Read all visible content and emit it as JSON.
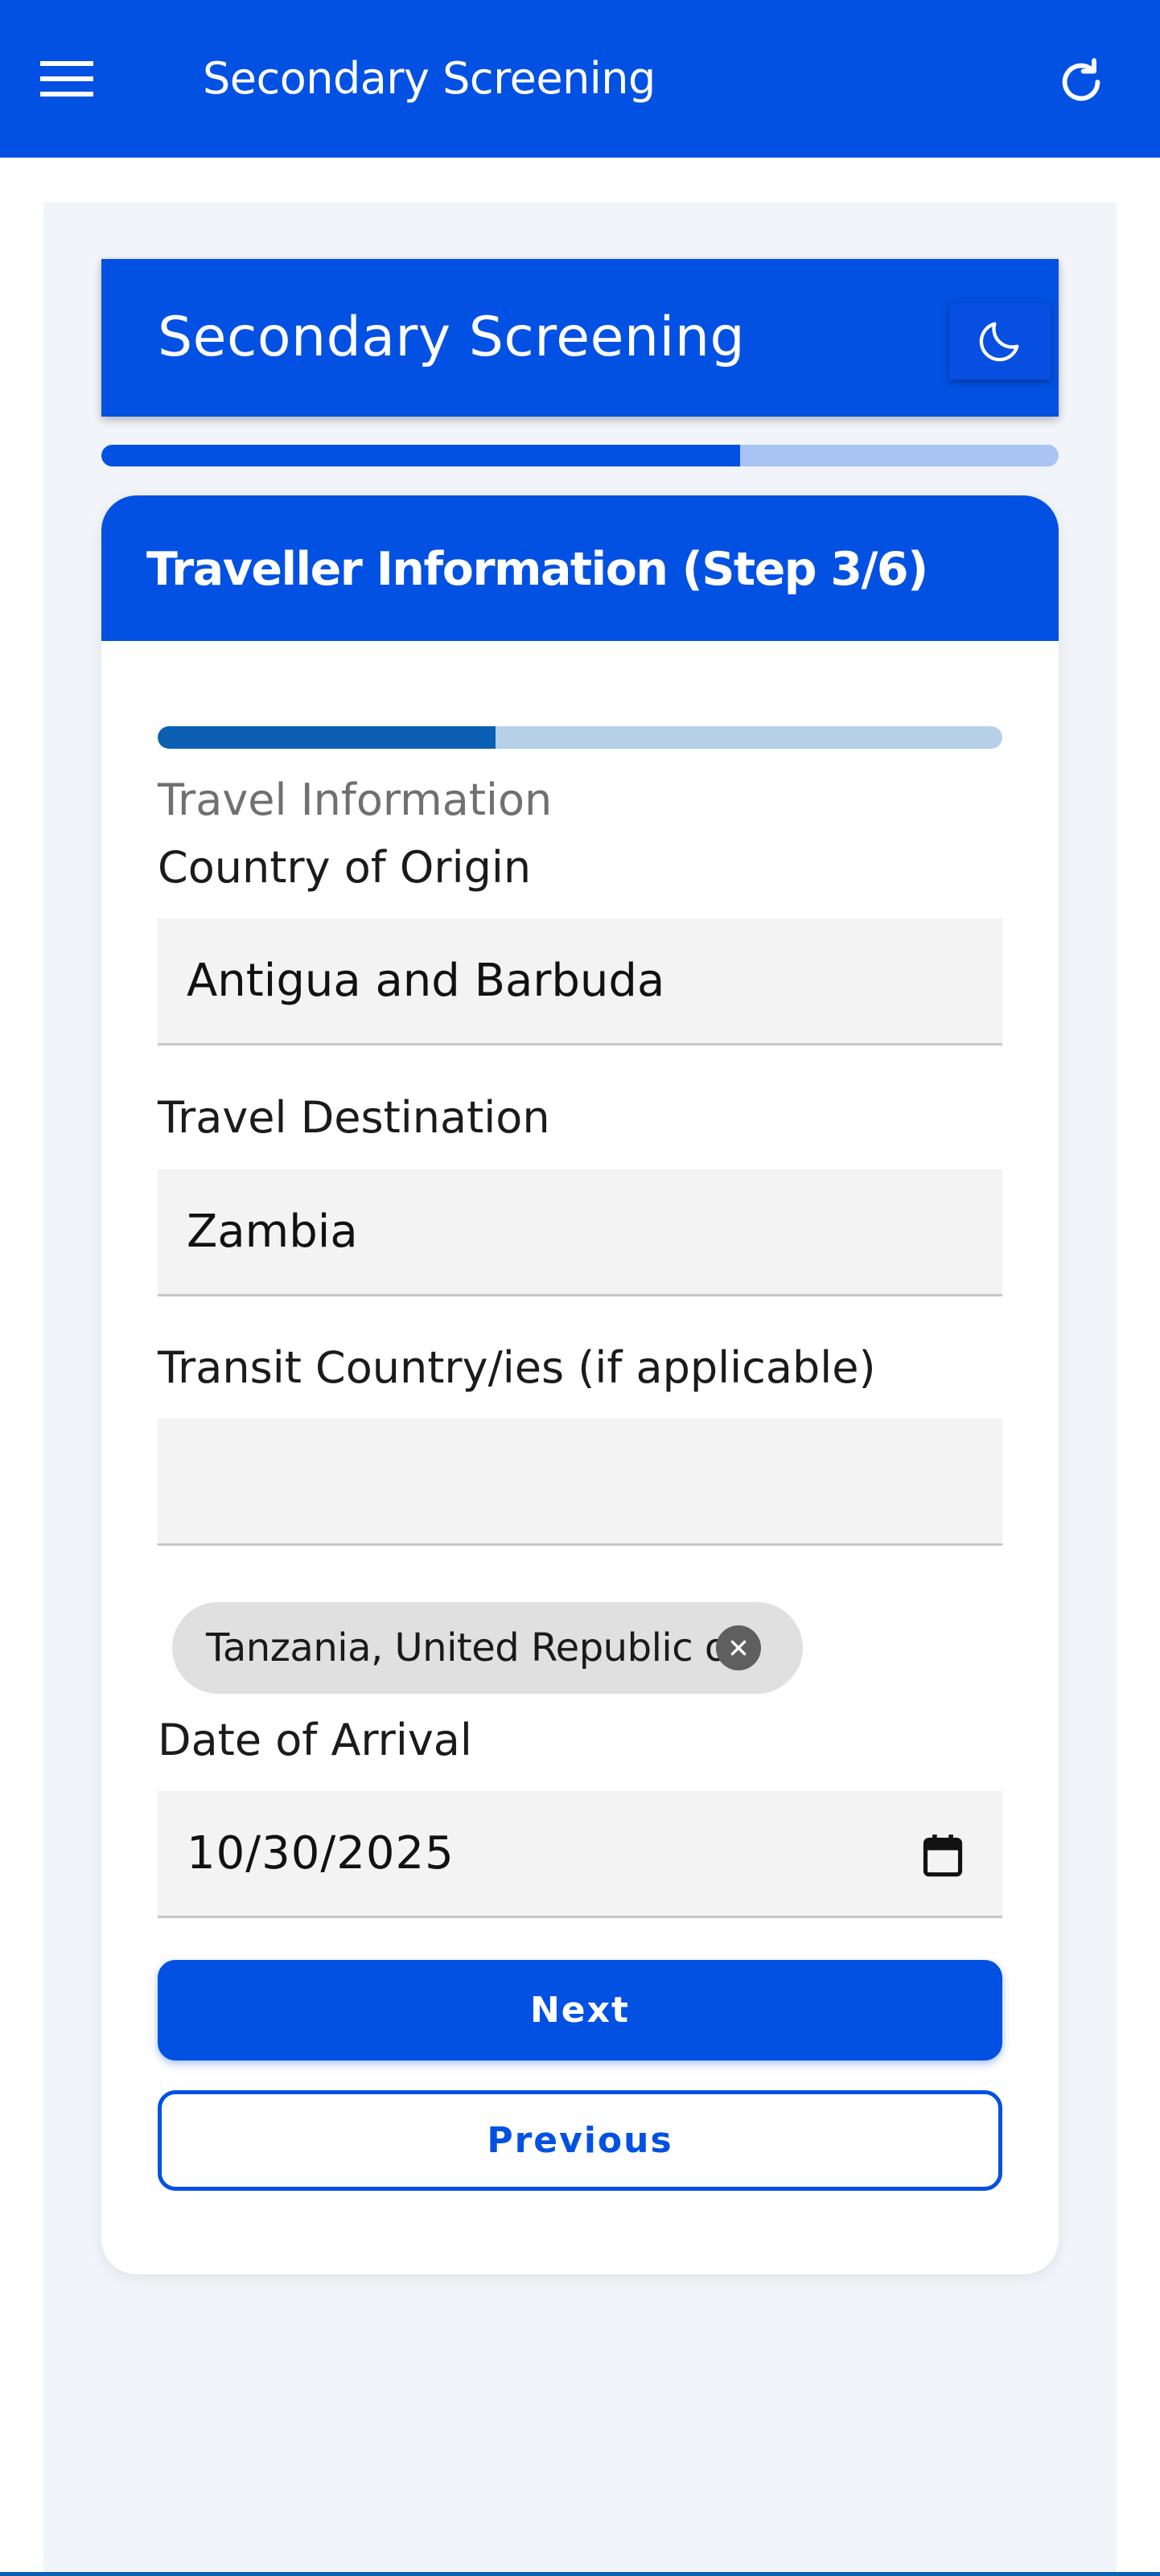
{
  "app_bar": {
    "title": "Secondary Screening",
    "menu_icon": "hamburger-menu-icon",
    "refresh_icon": "refresh-icon"
  },
  "hero": {
    "title": "Secondary Screening",
    "theme_icon": "moon-icon"
  },
  "overall_progress": {
    "fraction": 0.667
  },
  "card": {
    "title": "Traveller Information (Step 3/6)",
    "sub_progress": {
      "fraction": 0.4
    },
    "section_label": "Travel Information",
    "fields": {
      "country_of_origin": {
        "label": "Country of Origin",
        "value": "Antigua and Barbuda"
      },
      "travel_destination": {
        "label": "Travel Destination",
        "value": "Zambia"
      },
      "transit_countries": {
        "label": "Transit Country/ies (if applicable)",
        "value": "",
        "chips": [
          "Tanzania, United Republic of"
        ]
      },
      "date_of_arrival": {
        "label": "Date of Arrival",
        "value": "10/30/2025",
        "icon": "calendar-icon"
      }
    },
    "buttons": {
      "next": "Next",
      "previous": "Previous"
    }
  },
  "colors": {
    "primary": "#0351e3",
    "page_background": "#f1f4f8",
    "field_background": "#f3f3f3",
    "sub_progress_fill": "#0b60b3",
    "chip_background": "#e0e0e0"
  }
}
